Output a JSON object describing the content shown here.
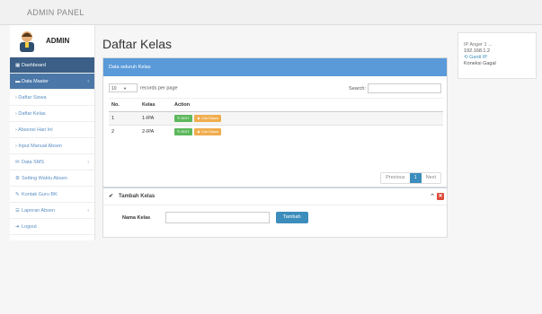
{
  "brand": {
    "title": "ADMIN PANEL"
  },
  "sidebar": {
    "admin_name": "ADMIN",
    "items": [
      {
        "label": "Dashboard",
        "icon": "grid-icon"
      },
      {
        "label": "Data Master",
        "icon": "folder-icon"
      },
      {
        "label": "› Daftar Siswa"
      },
      {
        "label": "› Daftar Kelas"
      },
      {
        "label": "› Absensi Hari Ini"
      },
      {
        "label": "› Input Manual Absen"
      },
      {
        "label": "Data SMS",
        "icon": "envelope-icon"
      },
      {
        "label": "Setting Waktu Absen",
        "icon": "gear-icon"
      },
      {
        "label": "Kontak Guru BK",
        "icon": "edit-icon"
      },
      {
        "label": "Laporan Absen",
        "icon": "users-icon"
      },
      {
        "label": "Logout",
        "icon": "logout-icon"
      }
    ]
  },
  "main": {
    "title": "Daftar Kelas",
    "panel_title": "Data seluruh Kelas",
    "length_value": "10",
    "length_suffix": "records per page",
    "search_label": "Search:",
    "columns": [
      "No.",
      "Kelas",
      "Action"
    ],
    "rows": [
      {
        "no": "1",
        "kelas": "1-IPA",
        "edit": "EDIT",
        "siswa": "Cek Siswa"
      },
      {
        "no": "2",
        "kelas": "2-IPA",
        "edit": "EDIT",
        "siswa": "Cek Siswa"
      }
    ],
    "pager": {
      "prev": "Previous",
      "page": "1",
      "next": "Next"
    }
  },
  "tambah": {
    "title": "Tambah Kelas",
    "label": "Nama Kelas",
    "input_value": "",
    "button": "Tambah"
  },
  "rightbox": {
    "line1": "IP Anger 1 ...",
    "line2": "192.168.1.2",
    "line3": "Ganti IP",
    "line4": "Koneksi Gagal"
  },
  "colors": {
    "nav_dark": "#3b5f87",
    "nav_active": "#4a77a8",
    "panel_header": "#5a9ad9",
    "edit_button": "#5cb85c",
    "siswa_button": "#f0ad4e",
    "close_button": "#dd4b39",
    "primary": "#3c8dbc"
  }
}
